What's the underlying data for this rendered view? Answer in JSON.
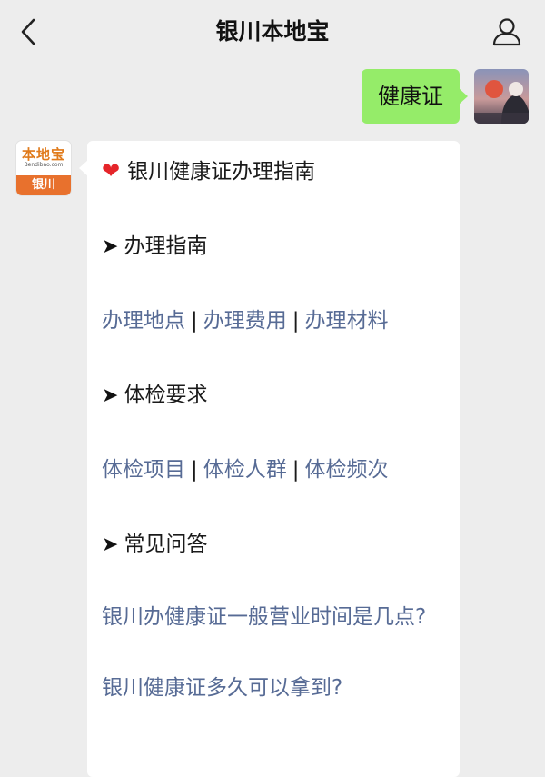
{
  "header": {
    "title": "银川本地宝"
  },
  "outgoing": {
    "text": "健康证"
  },
  "bot": {
    "logo_main": "本地宝",
    "logo_sub": "Bendibao.com",
    "logo_city": "银川"
  },
  "message": {
    "title": "银川健康证办理指南",
    "section1": {
      "heading": "办理指南",
      "links": [
        "办理地点",
        "办理费用",
        "办理材料"
      ],
      "separator": "|"
    },
    "section2": {
      "heading": "体检要求",
      "links": [
        "体检项目",
        "体检人群",
        "体检频次"
      ],
      "separator": "|"
    },
    "section3": {
      "heading": "常见问答",
      "q1": "银川办健康证一般营业时间是几点?",
      "q2": "银川健康证多久可以拿到?"
    }
  },
  "icons": {
    "back": "chevron-left-icon",
    "profile": "person-icon",
    "heart": "heart-icon",
    "arrow": "arrow-right-icon"
  },
  "colors": {
    "background": "#ededed",
    "outgoing_bubble": "#95ec69",
    "link": "#576b95",
    "logo_orange": "#e8712d"
  }
}
